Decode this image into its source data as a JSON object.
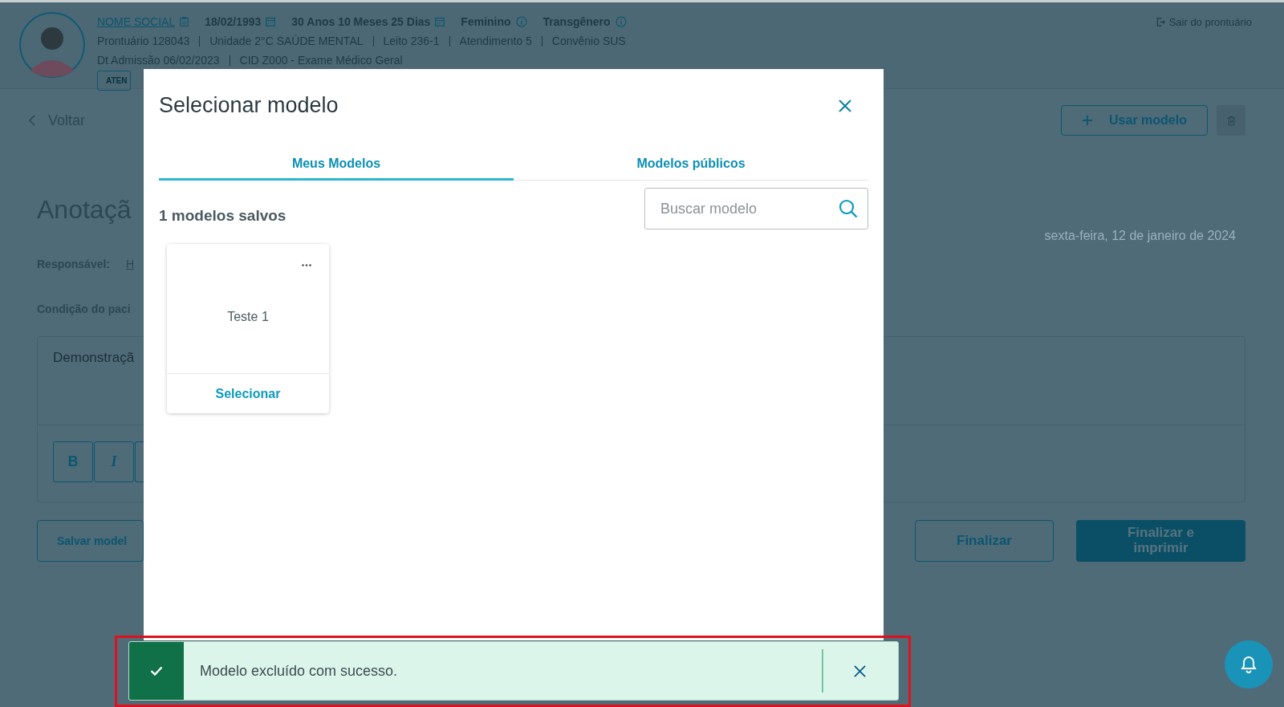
{
  "patient": {
    "name": "NOME SOCIAL",
    "facts": [
      {
        "kind": "date",
        "text": "18/02/1993"
      },
      {
        "kind": "date",
        "text": "30 Anos 10 Meses 25 Dias"
      },
      {
        "kind": "info",
        "text": "Feminino"
      },
      {
        "kind": "info",
        "text": "Transgênero"
      }
    ],
    "line_2": [
      "Prontuário 128043",
      "Unidade 2°C SAÚDE MENTAL",
      "Leito 236-1",
      "Atendimento 5",
      "Convênio SUS"
    ],
    "line_3": [
      "Dt Admissão 06/02/2023",
      "CID Z000 - Exame Médico Geral"
    ],
    "tag": "ATEN"
  },
  "exit_link": "Sair do prontuário",
  "back": "Voltar",
  "use_model_button": "Usar modelo",
  "title": "Anotaçã",
  "date": "sexta-feira, 12 de janeiro de 2024",
  "responsible_label": "Responsável:",
  "responsible_value": "H",
  "condition_label": "Condição do paci",
  "editor": {
    "text": "Demonstraçã",
    "toolbar": [
      {
        "kind": "bold",
        "label": "B"
      },
      {
        "kind": "italic",
        "label": "I"
      },
      {
        "kind": "hidden"
      }
    ]
  },
  "buttons": [
    {
      "kind": "outline",
      "label": "Salvar model"
    },
    {
      "kind": "outline",
      "label": "Finalizar"
    },
    {
      "kind": "primary",
      "label": "Finalizar e imprimir"
    }
  ],
  "modal": {
    "title": "Selecionar modelo",
    "tabs": [
      {
        "label": "Meus Modelos",
        "selected": true
      },
      {
        "label": "Modelos públicos",
        "selected": false
      }
    ],
    "count": "1 modelos salvos",
    "search": {
      "placeholder": "Buscar modelo"
    },
    "models": [
      {
        "name": "Teste 1",
        "action": "Selecionar"
      }
    ]
  },
  "toast": {
    "kind": "success",
    "message": "Modelo excluído com sucesso."
  }
}
